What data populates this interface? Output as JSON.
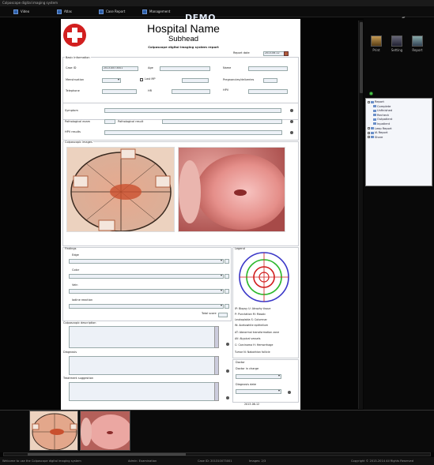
{
  "window": {
    "title": "Colposcope digital imaging system"
  },
  "menu": {
    "items": [
      {
        "label": "Video"
      },
      {
        "label": "Atlas"
      },
      {
        "label": "Case Report"
      },
      {
        "label": "Management"
      }
    ],
    "demo": "DEMO",
    "close": "«"
  },
  "report": {
    "hospital_name": "Hospital Name",
    "subhead": "Subhead",
    "subtitle": "Colposcope digital imaging system report",
    "report_date_label": "Report date",
    "report_date": "2013-06-12",
    "basic_info_title": "Basic Information",
    "fields": {
      "case_id_label": "Case ID",
      "case_id": "201310073001",
      "age_label": "Age",
      "name_label": "Name",
      "menstruation_label": "Menstruation",
      "last_mp_label": "Last MP",
      "pregnancies_label": "Pregnancies/deliveries",
      "telephone_label": "Telephone",
      "hr_label": "HR",
      "hpv_label": "HPV"
    },
    "symptom_label": "Symptom",
    "pathological_label": "Pathological exam",
    "pathological_result_label": "Pathological result",
    "hpv_results_label": "HPV results",
    "images_title": "Colposcopic images",
    "findings": {
      "title": "Findings",
      "edge_label": "Edge",
      "color_label": "Color",
      "vein_label": "Vein",
      "iodine_label": "Iodine reaction",
      "total_label": "Total score"
    },
    "legend": {
      "title": "Legend",
      "items": [
        "IP: Biopsy   U: Atrophy tissue",
        "P: Punctation   M: Mosaic",
        "Leukoplakia   S: Columnar",
        "W: Acetowhite epithelium",
        "AT: Abnormal transformation zone",
        "AV: Atypical vessels",
        "C: Carcinoma   H: Hemorrhage",
        "Tumor   N: Nabothian follicle"
      ]
    },
    "description_label": "Colposcopic description",
    "diagnosis_label": "Diagnosis",
    "suggestion_label": "Treatment suggestion",
    "doctor_title": "Doctor",
    "doctor_label": "Doctor in charge",
    "diagnosis_date_label": "Diagnosis date",
    "footer_date": "2013-06-12"
  },
  "right_panel": {
    "tools": [
      {
        "label": "Print"
      },
      {
        "label": "Setting"
      },
      {
        "label": "Report"
      }
    ],
    "tree": [
      {
        "label": "Report",
        "level": 0
      },
      {
        "label": "Complete",
        "level": 1
      },
      {
        "label": "Unfinished",
        "level": 1
      },
      {
        "label": "Recheck",
        "level": 1
      },
      {
        "label": "Outpatient",
        "level": 1
      },
      {
        "label": "Inpatient",
        "level": 1
      },
      {
        "label": "Leep Report",
        "level": 0
      },
      {
        "label": "IA Report",
        "level": 0
      },
      {
        "label": "Share",
        "level": 0
      }
    ]
  },
  "status": {
    "app": "Welcome to use the Colposcope digital imaging system",
    "user": "Admin:   Examination",
    "case": "Case ID: 201310073001",
    "images": "Images: 2/3",
    "copyright": "Copyright © 2013-2014  All Rights Reserved"
  }
}
